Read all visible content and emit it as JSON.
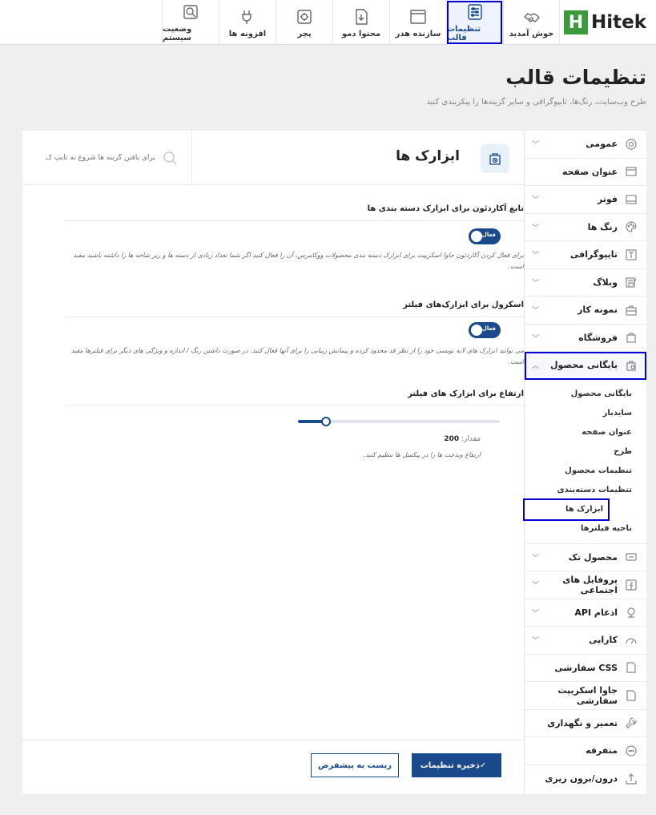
{
  "brand": {
    "logo_letter": "H",
    "logo_text": "Hitek",
    "accent": "#1a4a8c",
    "logo_green": "#3c9a3c"
  },
  "topbar": {
    "tabs": [
      {
        "label": "خوش آمدید",
        "icon": "handshake-icon"
      },
      {
        "label": "تنظیمات قالب",
        "icon": "settings-sliders-icon",
        "active": true
      },
      {
        "label": "سازنده هدر",
        "icon": "header-builder-icon"
      },
      {
        "label": "محتوا دمو",
        "icon": "demo-content-icon"
      },
      {
        "label": "پچر",
        "icon": "patcher-icon"
      },
      {
        "label": "افزونه ها",
        "icon": "plugins-icon"
      },
      {
        "label": "وضعیت سیستم",
        "icon": "system-status-icon"
      }
    ]
  },
  "page": {
    "title": "تنظیمات قالب",
    "subtitle": "طرح وب‌سایت، رنگ‌ها، تایپوگرافی و سایر گزینه‌ها را پیکربندی کنید"
  },
  "sidebar": {
    "items": [
      {
        "label": "عمومی",
        "icon": "gear-icon",
        "chevron": true
      },
      {
        "label": "عنوان صفحه",
        "icon": "page-title-icon",
        "chevron": false
      },
      {
        "label": "فوتر",
        "icon": "footer-icon",
        "chevron": true
      },
      {
        "label": "رنگ ها",
        "icon": "palette-icon",
        "chevron": true
      },
      {
        "label": "تایپوگرافی",
        "icon": "typography-icon",
        "chevron": true
      },
      {
        "label": "وبلاگ",
        "icon": "blog-icon",
        "chevron": true
      },
      {
        "label": "نمونه کار",
        "icon": "portfolio-icon",
        "chevron": true
      },
      {
        "label": "فروشگاه",
        "icon": "shop-bag-icon",
        "chevron": true
      },
      {
        "label": "بایگانی محصول",
        "icon": "product-archive-icon",
        "chevron": true,
        "expanded": true
      }
    ],
    "sub_items": [
      {
        "label": "بایگانی محصول"
      },
      {
        "label": "سایدبار"
      },
      {
        "label": "عنوان صفحه"
      },
      {
        "label": "طرح"
      },
      {
        "label": "تنظیمات محصول"
      },
      {
        "label": "تنظیمات دسته‌بندی"
      },
      {
        "label": "ابزارک ها",
        "active": true
      },
      {
        "label": "ناحیه فیلترها"
      }
    ],
    "items_after": [
      {
        "label": "محصول تک",
        "icon": "single-product-icon",
        "chevron": true
      },
      {
        "label": "پروفایل های اجتماعی",
        "icon": "facebook-icon",
        "chevron": true
      },
      {
        "label": "ادغام API",
        "icon": "api-icon",
        "chevron": true
      },
      {
        "label": "کارایی",
        "icon": "speedometer-icon",
        "chevron": true
      },
      {
        "label": "CSS سفارشی",
        "icon": "css-file-icon",
        "chevron": false
      },
      {
        "label": "جاوا اسکریپت سفارشی",
        "icon": "js-file-icon",
        "chevron": false
      },
      {
        "label": "تعمیر و نگهداری",
        "icon": "wrench-icon",
        "chevron": false
      },
      {
        "label": "متفرقه",
        "icon": "more-dots-icon",
        "chevron": false
      },
      {
        "label": "درون/برون ریزی",
        "icon": "upload-icon",
        "chevron": false
      }
    ]
  },
  "content": {
    "title": "ابزارک ها",
    "search_placeholder": "برای یافتن گزینه ها شروع به تایپ ک",
    "settings": {
      "accordion": {
        "title": "تابع آکاردئون برای ابزارک دسته بندی ها",
        "toggle_label": "فعال",
        "enabled": true,
        "desc": "برای فعال کردن آکاردئون جاوا اسکریپت برای ابزارک دسته بندی محصولات ووکامرس، آن را فعال کنید اگر شما تعداد زیادی از دسته ها و زیر شاخه ها را داشته باشید مفید است."
      },
      "scroll": {
        "title": "اسکرول برای ابزارک‌های فیلتر",
        "toggle_label": "فعال",
        "enabled": true,
        "desc": "می توانید ابزارک های لایه نویسی خود را از نظر قد محدود کرده و پیمایش زیبایی را برای آنها فعال کنید. در صورت داشتن رنگ / اندازه و ویژگی های دیگر برای فیلترها مفید است."
      },
      "height": {
        "title": "ارتفاع برای ابزارک های فیلتر",
        "value_label": "مقدار:",
        "value": 200,
        "slider_fraction": 0.14,
        "help": "ارتفاع ویدجت ها را در پیکسل ها تنظیم کنید."
      }
    }
  },
  "footer": {
    "save_label": "ذخیره تنظیمات",
    "reset_label": "ریست به پیشفرض"
  }
}
